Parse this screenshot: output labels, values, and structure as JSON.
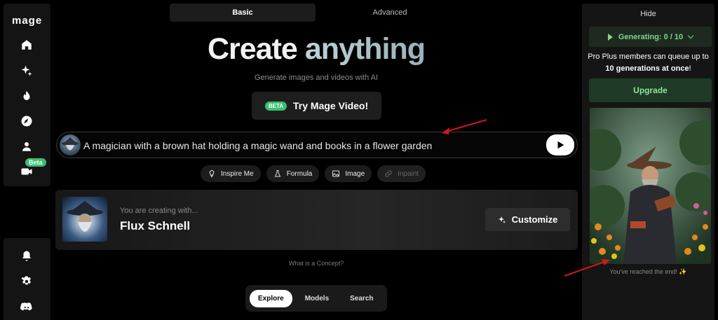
{
  "app": {
    "logo": "mage"
  },
  "sidebar": {
    "items": [
      {
        "name": "home",
        "icon": "home-icon"
      },
      {
        "name": "create",
        "icon": "sparkles-icon"
      },
      {
        "name": "trending",
        "icon": "flame-icon"
      },
      {
        "name": "explore",
        "icon": "compass-icon"
      },
      {
        "name": "profile",
        "icon": "user-icon"
      },
      {
        "name": "video",
        "icon": "video-icon",
        "badge": "Beta"
      }
    ],
    "bottom": [
      {
        "name": "notifications",
        "icon": "bell-icon"
      },
      {
        "name": "settings",
        "icon": "gear-icon"
      },
      {
        "name": "discord",
        "icon": "discord-icon"
      }
    ]
  },
  "mode_tabs": {
    "basic": "Basic",
    "advanced": "Advanced",
    "active": "Basic"
  },
  "hero": {
    "title_part1": "Create",
    "title_part2": "anything",
    "subtitle": "Generate images and videos with AI"
  },
  "video_cta": {
    "badge": "BETA",
    "label": "Try Mage Video!"
  },
  "prompt": {
    "value": "A magician with a brown hat holding a magic wand and books in a flower garden"
  },
  "chips": [
    {
      "label": "Inspire Me",
      "icon": "lightbulb-icon",
      "enabled": true
    },
    {
      "label": "Formula",
      "icon": "flask-icon",
      "enabled": true
    },
    {
      "label": "Image",
      "icon": "image-icon",
      "enabled": true
    },
    {
      "label": "Inpaint",
      "icon": "link-icon",
      "enabled": false
    }
  ],
  "concept": {
    "subtitle": "You are creating with...",
    "model": "Flux Schnell",
    "customize_label": "Customize"
  },
  "concept_link": "What is a Concept?",
  "bottom_tabs": {
    "explore": "Explore",
    "models": "Models",
    "search": "Search",
    "active": "Explore"
  },
  "panel": {
    "hide_label": "Hide",
    "generating_label": "Generating: 0 / 10",
    "promo_line1": "Pro Plus members can queue up to ",
    "promo_bold": "10 generations at once",
    "promo_end": "!",
    "upgrade_label": "Upgrade",
    "end_text": "You've reached the end! ✨"
  },
  "colors": {
    "accent_green": "#38c172",
    "upgrade_bg": "#1f3a26",
    "arrow_red": "#d01818"
  }
}
